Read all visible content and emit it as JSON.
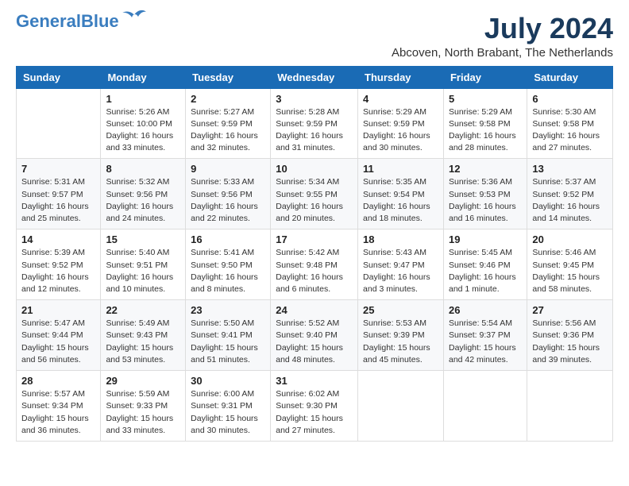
{
  "header": {
    "logo_line1": "General",
    "logo_line2": "Blue",
    "month_year": "July 2024",
    "location": "Abcoven, North Brabant, The Netherlands"
  },
  "days_of_week": [
    "Sunday",
    "Monday",
    "Tuesday",
    "Wednesday",
    "Thursday",
    "Friday",
    "Saturday"
  ],
  "weeks": [
    [
      {
        "day": "",
        "info": ""
      },
      {
        "day": "1",
        "info": "Sunrise: 5:26 AM\nSunset: 10:00 PM\nDaylight: 16 hours\nand 33 minutes."
      },
      {
        "day": "2",
        "info": "Sunrise: 5:27 AM\nSunset: 9:59 PM\nDaylight: 16 hours\nand 32 minutes."
      },
      {
        "day": "3",
        "info": "Sunrise: 5:28 AM\nSunset: 9:59 PM\nDaylight: 16 hours\nand 31 minutes."
      },
      {
        "day": "4",
        "info": "Sunrise: 5:29 AM\nSunset: 9:59 PM\nDaylight: 16 hours\nand 30 minutes."
      },
      {
        "day": "5",
        "info": "Sunrise: 5:29 AM\nSunset: 9:58 PM\nDaylight: 16 hours\nand 28 minutes."
      },
      {
        "day": "6",
        "info": "Sunrise: 5:30 AM\nSunset: 9:58 PM\nDaylight: 16 hours\nand 27 minutes."
      }
    ],
    [
      {
        "day": "7",
        "info": "Sunrise: 5:31 AM\nSunset: 9:57 PM\nDaylight: 16 hours\nand 25 minutes."
      },
      {
        "day": "8",
        "info": "Sunrise: 5:32 AM\nSunset: 9:56 PM\nDaylight: 16 hours\nand 24 minutes."
      },
      {
        "day": "9",
        "info": "Sunrise: 5:33 AM\nSunset: 9:56 PM\nDaylight: 16 hours\nand 22 minutes."
      },
      {
        "day": "10",
        "info": "Sunrise: 5:34 AM\nSunset: 9:55 PM\nDaylight: 16 hours\nand 20 minutes."
      },
      {
        "day": "11",
        "info": "Sunrise: 5:35 AM\nSunset: 9:54 PM\nDaylight: 16 hours\nand 18 minutes."
      },
      {
        "day": "12",
        "info": "Sunrise: 5:36 AM\nSunset: 9:53 PM\nDaylight: 16 hours\nand 16 minutes."
      },
      {
        "day": "13",
        "info": "Sunrise: 5:37 AM\nSunset: 9:52 PM\nDaylight: 16 hours\nand 14 minutes."
      }
    ],
    [
      {
        "day": "14",
        "info": "Sunrise: 5:39 AM\nSunset: 9:52 PM\nDaylight: 16 hours\nand 12 minutes."
      },
      {
        "day": "15",
        "info": "Sunrise: 5:40 AM\nSunset: 9:51 PM\nDaylight: 16 hours\nand 10 minutes."
      },
      {
        "day": "16",
        "info": "Sunrise: 5:41 AM\nSunset: 9:50 PM\nDaylight: 16 hours\nand 8 minutes."
      },
      {
        "day": "17",
        "info": "Sunrise: 5:42 AM\nSunset: 9:48 PM\nDaylight: 16 hours\nand 6 minutes."
      },
      {
        "day": "18",
        "info": "Sunrise: 5:43 AM\nSunset: 9:47 PM\nDaylight: 16 hours\nand 3 minutes."
      },
      {
        "day": "19",
        "info": "Sunrise: 5:45 AM\nSunset: 9:46 PM\nDaylight: 16 hours\nand 1 minute."
      },
      {
        "day": "20",
        "info": "Sunrise: 5:46 AM\nSunset: 9:45 PM\nDaylight: 15 hours\nand 58 minutes."
      }
    ],
    [
      {
        "day": "21",
        "info": "Sunrise: 5:47 AM\nSunset: 9:44 PM\nDaylight: 15 hours\nand 56 minutes."
      },
      {
        "day": "22",
        "info": "Sunrise: 5:49 AM\nSunset: 9:43 PM\nDaylight: 15 hours\nand 53 minutes."
      },
      {
        "day": "23",
        "info": "Sunrise: 5:50 AM\nSunset: 9:41 PM\nDaylight: 15 hours\nand 51 minutes."
      },
      {
        "day": "24",
        "info": "Sunrise: 5:52 AM\nSunset: 9:40 PM\nDaylight: 15 hours\nand 48 minutes."
      },
      {
        "day": "25",
        "info": "Sunrise: 5:53 AM\nSunset: 9:39 PM\nDaylight: 15 hours\nand 45 minutes."
      },
      {
        "day": "26",
        "info": "Sunrise: 5:54 AM\nSunset: 9:37 PM\nDaylight: 15 hours\nand 42 minutes."
      },
      {
        "day": "27",
        "info": "Sunrise: 5:56 AM\nSunset: 9:36 PM\nDaylight: 15 hours\nand 39 minutes."
      }
    ],
    [
      {
        "day": "28",
        "info": "Sunrise: 5:57 AM\nSunset: 9:34 PM\nDaylight: 15 hours\nand 36 minutes."
      },
      {
        "day": "29",
        "info": "Sunrise: 5:59 AM\nSunset: 9:33 PM\nDaylight: 15 hours\nand 33 minutes."
      },
      {
        "day": "30",
        "info": "Sunrise: 6:00 AM\nSunset: 9:31 PM\nDaylight: 15 hours\nand 30 minutes."
      },
      {
        "day": "31",
        "info": "Sunrise: 6:02 AM\nSunset: 9:30 PM\nDaylight: 15 hours\nand 27 minutes."
      },
      {
        "day": "",
        "info": ""
      },
      {
        "day": "",
        "info": ""
      },
      {
        "day": "",
        "info": ""
      }
    ]
  ]
}
